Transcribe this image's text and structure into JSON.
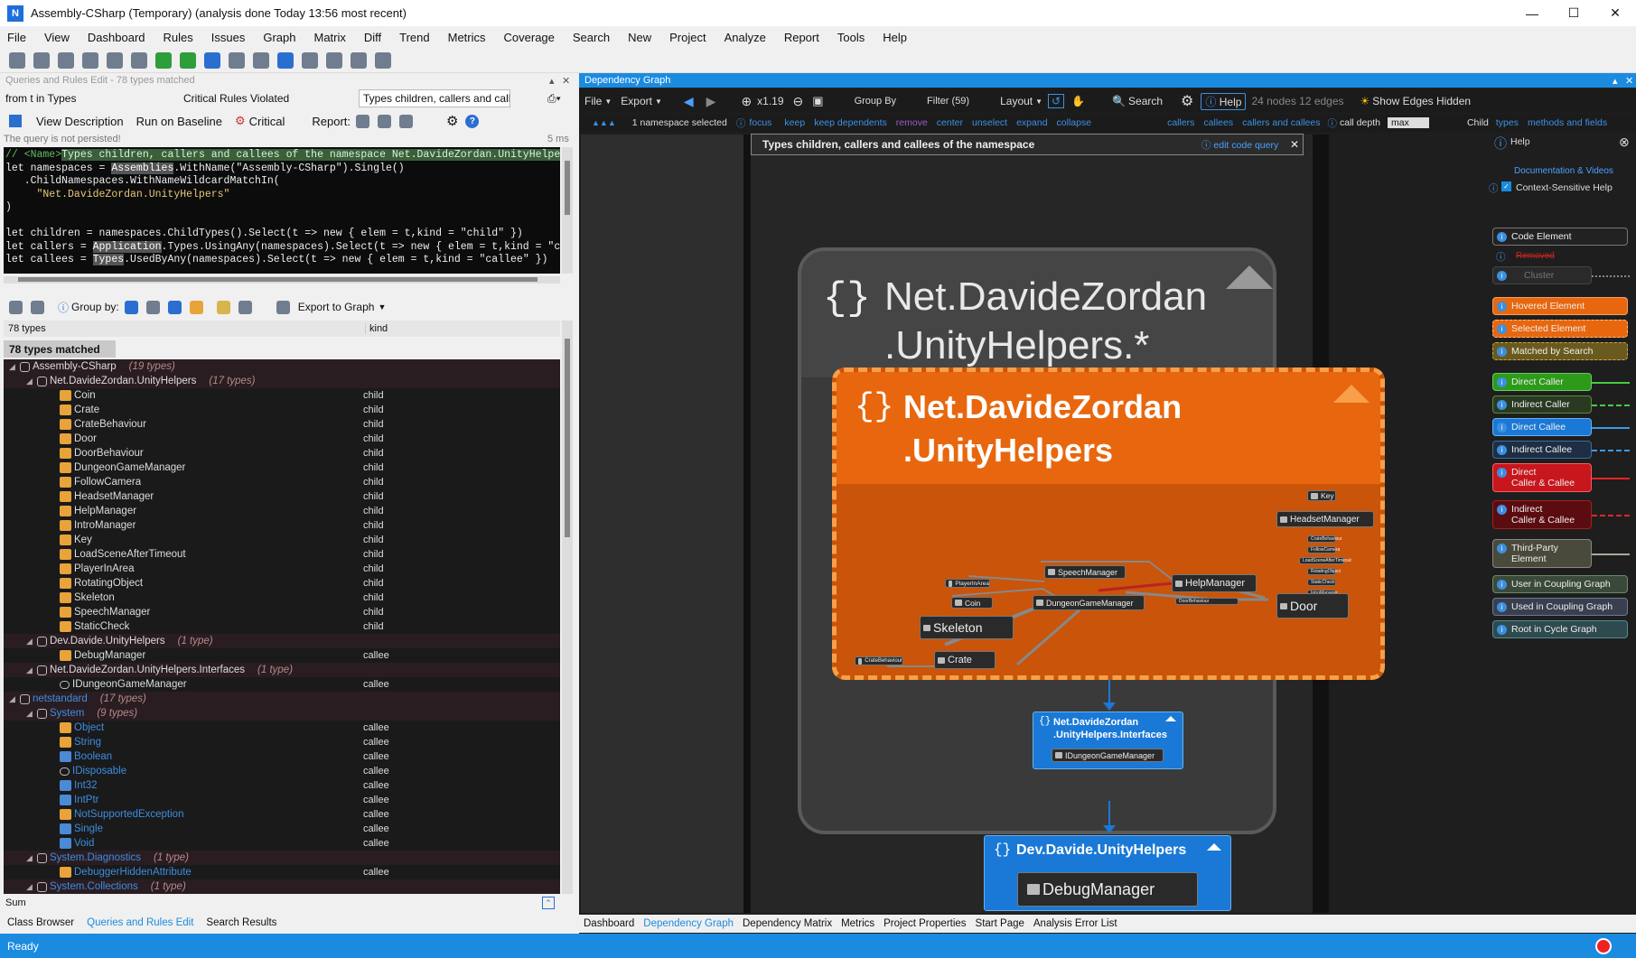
{
  "window": {
    "title": "Assembly-CSharp (Temporary)  (analysis done Today 13:56 most recent)",
    "icon": "ndepend-app-icon"
  },
  "menu": [
    "File",
    "View",
    "Dashboard",
    "Rules",
    "Issues",
    "Graph",
    "Matrix",
    "Diff",
    "Trend",
    "Metrics",
    "Coverage",
    "Search",
    "New",
    "Project",
    "Analyze",
    "Report",
    "Tools",
    "Help"
  ],
  "left": {
    "header": "Queries and Rules Edit  -  78 types matched",
    "query_left": "from t in Types where t.FullNa...",
    "critical_violated": "Critical Rules Violated",
    "query_title_field": "Types children, callers and calle...",
    "view_description": "View Description",
    "run_on_baseline": "Run on Baseline",
    "critical": "Critical",
    "report": "Report:",
    "not_persisted": "The query is not persisted!",
    "elapsed": "5 ms",
    "group_by": "Group by:",
    "export_to_graph": "Export to Graph",
    "col_types": "78 types",
    "col_kind": "kind",
    "matched": "78 types matched",
    "sum": "Sum",
    "tabs": [
      "Class Browser",
      "Queries and Rules Edit",
      "Search Results"
    ]
  },
  "code": {
    "line1a": "// <Name>",
    "line1b": "Types children, callers and callees of the namespace Net.DavideZordan.UnityHelpers</Nam",
    "line2a": "let namespaces = ",
    "line2b": "Assemblies",
    "line2c": ".WithName(\"Assembly-CSharp\").Single()",
    "line3": "   .ChildNamespaces.WithNameWildcardMatchIn(",
    "line4": "     \"Net.DavideZordan.UnityHelpers\"",
    "line5": ")",
    "line7": "let children = namespaces.ChildTypes().Select(t => new { elem = t,kind = \"child\" })",
    "line8a": "let callers = ",
    "line8b": "Application",
    "line8c": ".Types.UsingAny(namespaces).Select(t => new { elem = t,kind = \"caller\"",
    "line9a": "let callees = ",
    "line9b": "Types",
    "line9c": ".UsedByAny(namespaces).Select(t => new { elem = t,kind = \"callee\" })"
  },
  "rows": [
    {
      "name": "Assembly-CSharp",
      "count": "(19 types)",
      "kind": "",
      "indent": 0,
      "type": "asm",
      "group": true
    },
    {
      "name": "Net.DavideZordan.UnityHelpers",
      "count": "(17 types)",
      "kind": "",
      "indent": 1,
      "type": "ns",
      "group": true
    },
    {
      "name": "Coin",
      "kind": "child",
      "indent": 2,
      "type": "cls"
    },
    {
      "name": "Crate",
      "kind": "child",
      "indent": 2,
      "type": "cls"
    },
    {
      "name": "CrateBehaviour",
      "kind": "child",
      "indent": 2,
      "type": "cls"
    },
    {
      "name": "Door",
      "kind": "child",
      "indent": 2,
      "type": "cls"
    },
    {
      "name": "DoorBehaviour",
      "kind": "child",
      "indent": 2,
      "type": "cls"
    },
    {
      "name": "DungeonGameManager",
      "kind": "child",
      "indent": 2,
      "type": "cls"
    },
    {
      "name": "FollowCamera",
      "kind": "child",
      "indent": 2,
      "type": "cls"
    },
    {
      "name": "HeadsetManager",
      "kind": "child",
      "indent": 2,
      "type": "cls"
    },
    {
      "name": "HelpManager",
      "kind": "child",
      "indent": 2,
      "type": "cls"
    },
    {
      "name": "IntroManager",
      "kind": "child",
      "indent": 2,
      "type": "cls"
    },
    {
      "name": "Key",
      "kind": "child",
      "indent": 2,
      "type": "cls"
    },
    {
      "name": "LoadSceneAfterTimeout",
      "kind": "child",
      "indent": 2,
      "type": "cls"
    },
    {
      "name": "PlayerInArea",
      "kind": "child",
      "indent": 2,
      "type": "cls"
    },
    {
      "name": "RotatingObject",
      "kind": "child",
      "indent": 2,
      "type": "cls"
    },
    {
      "name": "Skeleton",
      "kind": "child",
      "indent": 2,
      "type": "cls"
    },
    {
      "name": "SpeechManager",
      "kind": "child",
      "indent": 2,
      "type": "cls"
    },
    {
      "name": "StaticCheck",
      "kind": "child",
      "indent": 2,
      "type": "cls"
    },
    {
      "name": "Dev.Davide.UnityHelpers",
      "count": "(1 type)",
      "kind": "",
      "indent": 1,
      "type": "ns",
      "group": true
    },
    {
      "name": "DebugManager",
      "kind": "callee",
      "indent": 2,
      "type": "cls"
    },
    {
      "name": "Net.DavideZordan.UnityHelpers.Interfaces",
      "count": "(1 type)",
      "kind": "",
      "indent": 1,
      "type": "ns",
      "group": true
    },
    {
      "name": "IDungeonGameManager",
      "kind": "callee",
      "indent": 2,
      "type": "itf"
    },
    {
      "name": "netstandard",
      "count": "(17 types)",
      "kind": "",
      "indent": 0,
      "type": "asm",
      "group": true,
      "blue": true
    },
    {
      "name": "System",
      "count": "(9 types)",
      "kind": "",
      "indent": 1,
      "type": "ns",
      "group": true,
      "blue": true
    },
    {
      "name": "Object",
      "kind": "callee",
      "indent": 2,
      "type": "cls",
      "blue": true
    },
    {
      "name": "String",
      "kind": "callee",
      "indent": 2,
      "type": "cls",
      "blue": true
    },
    {
      "name": "Boolean",
      "kind": "callee",
      "indent": 2,
      "type": "st",
      "blue": true
    },
    {
      "name": "IDisposable",
      "kind": "callee",
      "indent": 2,
      "type": "itf",
      "blue": true
    },
    {
      "name": "Int32",
      "kind": "callee",
      "indent": 2,
      "type": "st",
      "blue": true
    },
    {
      "name": "IntPtr",
      "kind": "callee",
      "indent": 2,
      "type": "st",
      "blue": true
    },
    {
      "name": "NotSupportedException",
      "kind": "callee",
      "indent": 2,
      "type": "cls",
      "blue": true
    },
    {
      "name": "Single",
      "kind": "callee",
      "indent": 2,
      "type": "st",
      "blue": true
    },
    {
      "name": "Void",
      "kind": "callee",
      "indent": 2,
      "type": "st",
      "blue": true
    },
    {
      "name": "System.Diagnostics",
      "count": "(1 type)",
      "kind": "",
      "indent": 1,
      "type": "ns",
      "group": true,
      "blue": true
    },
    {
      "name": "DebuggerHiddenAttribute",
      "kind": "callee",
      "indent": 2,
      "type": "cls",
      "blue": true
    },
    {
      "name": "System.Collections",
      "count": "(1 type)",
      "kind": "",
      "indent": 1,
      "type": "ns",
      "group": true,
      "blue": true
    }
  ],
  "graph": {
    "header": "Dependency Graph",
    "file": "File",
    "export": "Export",
    "zoom": "x1.19",
    "group_by": "Group By",
    "filter": "Filter (59)",
    "layout": "Layout",
    "search": "Search",
    "help": "Help",
    "counts": "24 nodes 12 edges",
    "show_edges_hidden": "Show Edges Hidden",
    "selected": "1 namespace selected",
    "links": [
      "focus",
      "keep",
      "keep dependents",
      "remove",
      "center",
      "unselect",
      "expand",
      "collapse"
    ],
    "links2": [
      "callers",
      "callees",
      "callers and callees"
    ],
    "call_depth": "call depth",
    "depth_value": "max",
    "child": "Child",
    "types": "types",
    "methods_fields": "methods and fields",
    "banner": "Types children, callers and callees of the namespace",
    "edit_code_query": "edit code query",
    "outer_title1": "Net.DavideZordan",
    "outer_title2": ".UnityHelpers.*",
    "inner_title1": "Net.DavideZordan",
    "inner_title2": ".UnityHelpers",
    "interfaces_title1": "Net.DavideZordan",
    "interfaces_title2": ".UnityHelpers.Interfaces",
    "interfaces_node": "IDungeonGameManager",
    "dev_title": "Dev.Davide.UnityHelpers",
    "dev_node": "DebugManager",
    "nodes": {
      "key": "Key",
      "headset": "HeadsetManager",
      "speech": "SpeechManager",
      "helpmgr": "HelpManager",
      "player": "PlayerInArea",
      "coin": "Coin",
      "dungeon": "DungeonGameManager",
      "door": "Door",
      "skeleton": "Skeleton",
      "crate": "Crate",
      "crateb": "CrateBehaviour",
      "doorb": "DoorBehaviour",
      "static": "StaticCheck",
      "follow": "FollowCamera",
      "intro": "IntroManager",
      "loadscene": "LoadSceneAfterTimeout",
      "rotating": "RotatingObject"
    },
    "tabs": [
      "Dashboard",
      "Dependency Graph",
      "Dependency Matrix",
      "Metrics",
      "Project Properties",
      "Start Page",
      "Analysis Error List"
    ]
  },
  "help": {
    "title": "Help",
    "docs": "Documentation & Videos",
    "context": "Context-Sensitive Help",
    "code_element": "Code Element",
    "removed": "Removed",
    "cluster": "Cluster",
    "hovered": "Hovered Element",
    "selected": "Selected Element",
    "matched": "Matched by Search",
    "direct_caller": "Direct Caller",
    "indirect_caller": "Indirect Caller",
    "direct_callee": "Direct Callee",
    "indirect_callee": "Indirect Callee",
    "direct_cc1": "Direct",
    "direct_cc2": "Caller & Callee",
    "indirect_cc1": "Indirect",
    "indirect_cc2": "Caller & Callee",
    "thirdparty1": "Third-Party",
    "thirdparty2": "Element",
    "user_coupling": "User in Coupling Graph",
    "used_coupling": "Used in Coupling Graph",
    "root_cycle": "Root in Cycle Graph"
  },
  "status": "Ready",
  "colors": {
    "accent": "#1b8be0",
    "orange": "#e8670e",
    "callee_blue": "#1a79d6"
  }
}
